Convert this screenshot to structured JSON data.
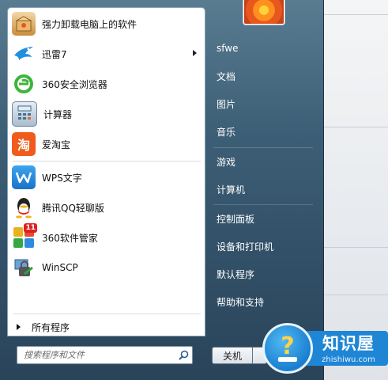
{
  "programs": [
    {
      "label": "强力卸载电脑上的软件",
      "icon": "uninstaller-box-icon",
      "has_submenu": false
    },
    {
      "label": "迅雷7",
      "icon": "xunlei-bird-icon",
      "has_submenu": true
    },
    {
      "label": "360安全浏览器",
      "icon": "360-browser-icon",
      "has_submenu": false
    },
    {
      "label": "计算器",
      "icon": "calculator-icon",
      "has_submenu": false
    },
    {
      "label": "爱淘宝",
      "icon": "taobao-icon",
      "has_submenu": false
    },
    {
      "label": "WPS文字",
      "icon": "wps-writer-icon",
      "has_submenu": false
    },
    {
      "label": "腾讯QQ轻聊版",
      "icon": "qq-penguin-icon",
      "has_submenu": false
    },
    {
      "label": "360软件管家",
      "icon": "360-software-manager-icon",
      "has_submenu": false,
      "badge": "11"
    },
    {
      "label": "WinSCP",
      "icon": "winscp-icon",
      "has_submenu": false
    }
  ],
  "all_programs_label": "所有程序",
  "search": {
    "placeholder": "搜索程序和文件"
  },
  "places": [
    {
      "label": "sfwe"
    },
    {
      "label": "文档"
    },
    {
      "label": "图片"
    },
    {
      "label": "音乐"
    },
    {
      "label": "游戏"
    },
    {
      "label": "计算机"
    },
    {
      "label": "控制面板"
    },
    {
      "label": "设备和打印机"
    },
    {
      "label": "默认程序"
    },
    {
      "label": "帮助和支持"
    }
  ],
  "shutdown_label": "关机",
  "watermark": {
    "title": "知识屋",
    "subtitle": "zhishiwu.com",
    "badge_char": "?"
  },
  "colors": {
    "frame": "#3d5f76",
    "watermark_blue": "#1f86d6"
  }
}
